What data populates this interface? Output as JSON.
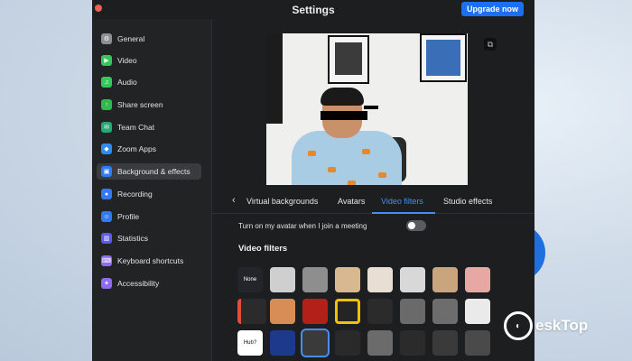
{
  "window": {
    "title": "Settings",
    "upgrade_label": "Upgrade now"
  },
  "sidebar": {
    "items": [
      {
        "label": "General",
        "icon": "gear-icon",
        "color": "#8e8e93"
      },
      {
        "label": "Video",
        "icon": "video-icon",
        "color": "#34c759"
      },
      {
        "label": "Audio",
        "icon": "headphones-icon",
        "color": "#34c759"
      },
      {
        "label": "Share screen",
        "icon": "share-screen-icon",
        "color": "#30b94f"
      },
      {
        "label": "Team Chat",
        "icon": "chat-icon",
        "color": "#27a876"
      },
      {
        "label": "Zoom Apps",
        "icon": "apps-icon",
        "color": "#2d8cf0"
      },
      {
        "label": "Background & effects",
        "icon": "background-icon",
        "color": "#2f7df6",
        "active": true
      },
      {
        "label": "Recording",
        "icon": "recording-icon",
        "color": "#3478f6"
      },
      {
        "label": "Profile",
        "icon": "profile-icon",
        "color": "#3478f6"
      },
      {
        "label": "Statistics",
        "icon": "statistics-icon",
        "color": "#5e5ce6"
      },
      {
        "label": "Keyboard shortcuts",
        "icon": "keyboard-icon",
        "color": "#8e6cf0"
      },
      {
        "label": "Accessibility",
        "icon": "accessibility-icon",
        "color": "#8e6cf0"
      }
    ]
  },
  "tabs": {
    "items": [
      "Virtual backgrounds",
      "Avatars",
      "Video filters",
      "Studio effects"
    ],
    "active_index": 2
  },
  "avatar_toggle": {
    "label": "Turn on my avatar when I join a meeting",
    "checked": false
  },
  "filters": {
    "section_title": "Video filters",
    "none_label": "None",
    "speech_label": "Hub?",
    "selected_index": 18
  },
  "watermark": {
    "text": "eskTop"
  },
  "colors": {
    "accent": "#4a8cf7",
    "upgrade": "#1b6ff0",
    "bg_dark": "#1d1e20"
  }
}
